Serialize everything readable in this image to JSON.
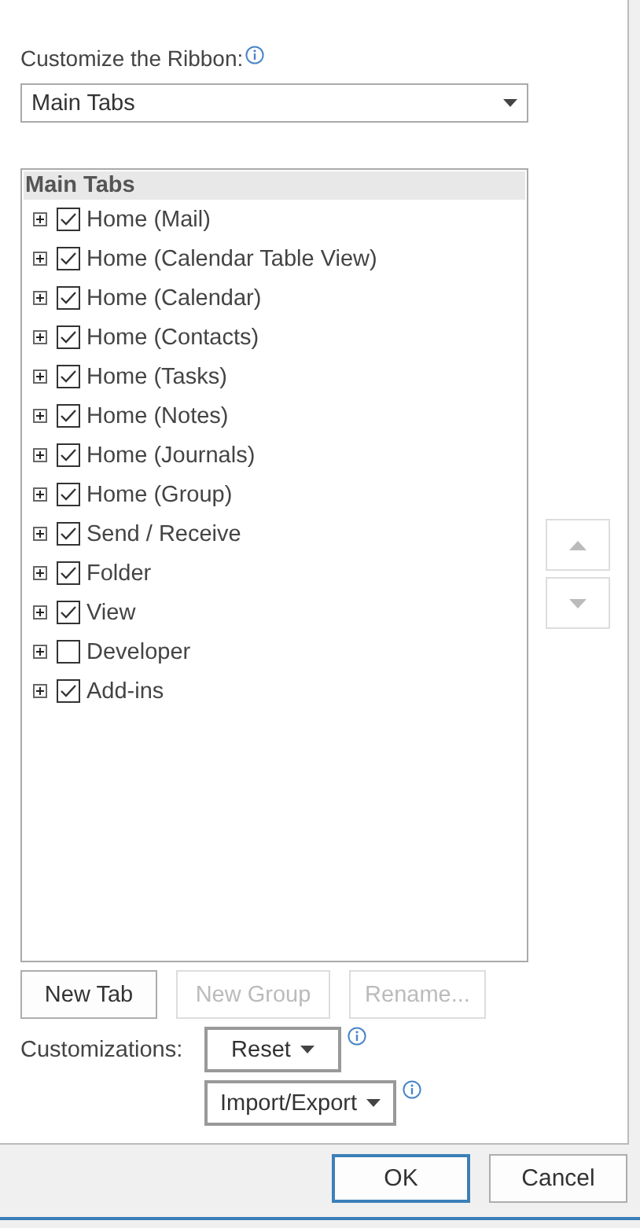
{
  "customize_label": "Customize the Ribbon:",
  "ribbon_select": {
    "value": "Main Tabs"
  },
  "tab_list": {
    "header": "Main Tabs",
    "items": [
      {
        "label": "Home (Mail)",
        "checked": true,
        "expanded": false
      },
      {
        "label": "Home (Calendar Table View)",
        "checked": true,
        "expanded": false
      },
      {
        "label": "Home (Calendar)",
        "checked": true,
        "expanded": false
      },
      {
        "label": "Home (Contacts)",
        "checked": true,
        "expanded": false
      },
      {
        "label": "Home (Tasks)",
        "checked": true,
        "expanded": false
      },
      {
        "label": "Home (Notes)",
        "checked": true,
        "expanded": false
      },
      {
        "label": "Home (Journals)",
        "checked": true,
        "expanded": false
      },
      {
        "label": "Home (Group)",
        "checked": true,
        "expanded": false
      },
      {
        "label": "Send / Receive",
        "checked": true,
        "expanded": false
      },
      {
        "label": "Folder",
        "checked": true,
        "expanded": false
      },
      {
        "label": "View",
        "checked": true,
        "expanded": false
      },
      {
        "label": "Developer",
        "checked": false,
        "expanded": false
      },
      {
        "label": "Add-ins",
        "checked": true,
        "expanded": false
      }
    ]
  },
  "move_buttons": [
    {
      "kind": "up",
      "disabled": true
    },
    {
      "kind": "down",
      "disabled": true
    }
  ],
  "list_buttons": [
    {
      "label": "New Tab",
      "disabled": false
    },
    {
      "label": "New Group",
      "disabled": true
    },
    {
      "label": "Rename...",
      "disabled": true
    }
  ],
  "customizations": {
    "label": "Customizations:",
    "buttons": [
      {
        "label": "Reset"
      },
      {
        "label": "Import/Export"
      }
    ]
  },
  "dialog_buttons": [
    {
      "label": "OK",
      "focused": true
    },
    {
      "label": "Cancel",
      "focused": false
    }
  ]
}
